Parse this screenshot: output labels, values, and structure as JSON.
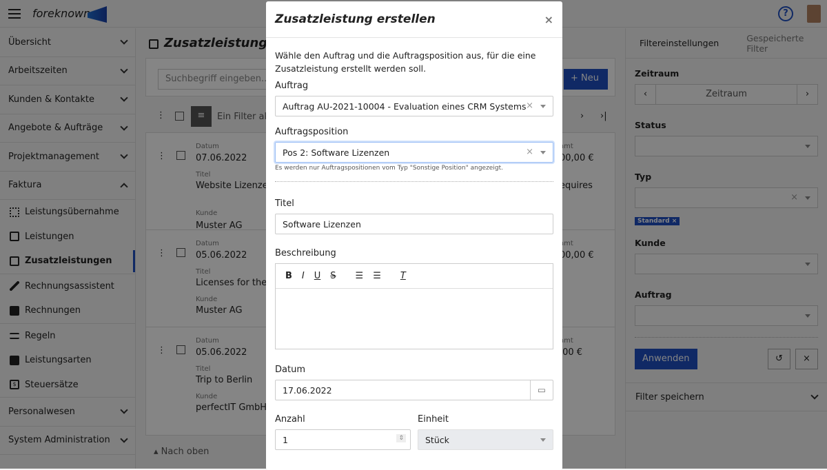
{
  "topbar": {
    "brand": "foreknown",
    "help_icon": "help-icon",
    "avatar": "user-avatar"
  },
  "sidebar": {
    "items": [
      {
        "label": "Übersicht"
      },
      {
        "label": "Arbeitszeiten"
      },
      {
        "label": "Kunden & Kontakte"
      },
      {
        "label": "Angebote & Aufträge"
      },
      {
        "label": "Projektmanagement"
      },
      {
        "label": "Faktura"
      }
    ],
    "faktura_items": [
      {
        "label": "Leistungsübernahme",
        "icon": "import-icon"
      },
      {
        "label": "Leistungen",
        "icon": "chart-icon"
      },
      {
        "label": "Zusatzleistungen",
        "icon": "chart-plus-icon",
        "active": true
      },
      {
        "label": "Rechnungsassistent",
        "icon": "wand-icon"
      },
      {
        "label": "Rechnungen",
        "icon": "invoice-icon"
      },
      {
        "label": "Regeln",
        "icon": "rules-icon"
      },
      {
        "label": "Leistungsarten",
        "icon": "chart-filled-icon"
      },
      {
        "label": "Steuersätze",
        "icon": "tax-icon"
      }
    ],
    "bottom_items": [
      {
        "label": "Personalwesen"
      },
      {
        "label": "System Administration"
      }
    ]
  },
  "main": {
    "title": "Zusatzleistungen",
    "search_placeholder": "Suchbegriff eingeben...",
    "new_label": "Neu",
    "filter_text": "Ein Filter akt",
    "records": [
      {
        "datum_label": "Datum",
        "datum": "07.06.2022",
        "titel_label": "Titel",
        "titel": "Website Lizenzen",
        "kunde_label": "Kunde",
        "kunde": "Muster AG",
        "gesamt_label": "amt",
        "gesamt": "00,00 €",
        "extra": "equires"
      },
      {
        "datum_label": "Datum",
        "datum": "05.06.2022",
        "titel_label": "Titel",
        "titel": "Licenses for the W",
        "kunde_label": "Kunde",
        "kunde": "Muster AG",
        "gesamt_label": "amt",
        "gesamt": "00,00 €"
      },
      {
        "datum_label": "Datum",
        "datum": "05.06.2022",
        "titel_label": "Titel",
        "titel": "Trip to Berlin",
        "kunde_label": "Kunde",
        "kunde": "perfectIT GmbH",
        "gesamt_label": "amt",
        "gesamt": ",00 €"
      }
    ],
    "back_to_top": "Nach oben"
  },
  "filters": {
    "tab_settings": "Filtereinstellungen",
    "tab_saved": "Gespeicherte Filter",
    "zeitraum_label": "Zeitraum",
    "zeitraum_value": "Zeitraum",
    "status_label": "Status",
    "typ_label": "Typ",
    "typ_tag": "Standard",
    "kunde_label": "Kunde",
    "auftrag_label": "Auftrag",
    "apply": "Anwenden",
    "save_filter": "Filter speichern"
  },
  "modal": {
    "title": "Zusatzleistung erstellen",
    "intro": "Wähle den Auftrag und die Auftragsposition aus, für die eine Zusatzleistung erstellt werden soll.",
    "auftrag_label": "Auftrag",
    "auftrag_value": "Auftrag AU-2021-10004 - Evaluation eines CRM Systems",
    "position_label": "Auftragsposition",
    "position_value": "Pos 2: Software Lizenzen",
    "position_hint": "Es werden nur Auftragspositionen vom Typ \"Sonstige Position\" angezeigt.",
    "titel_label": "Titel",
    "titel_value": "Software Lizenzen",
    "beschreibung_label": "Beschreibung",
    "toolbar": [
      "B",
      "I",
      "U",
      "S"
    ],
    "datum_label": "Datum",
    "datum_value": "17.06.2022",
    "anzahl_label": "Anzahl",
    "anzahl_value": "1",
    "einheit_label": "Einheit",
    "einheit_value": "Stück"
  },
  "colors": {
    "accent": "#1f4fc1",
    "focus": "#9ec0f5"
  }
}
